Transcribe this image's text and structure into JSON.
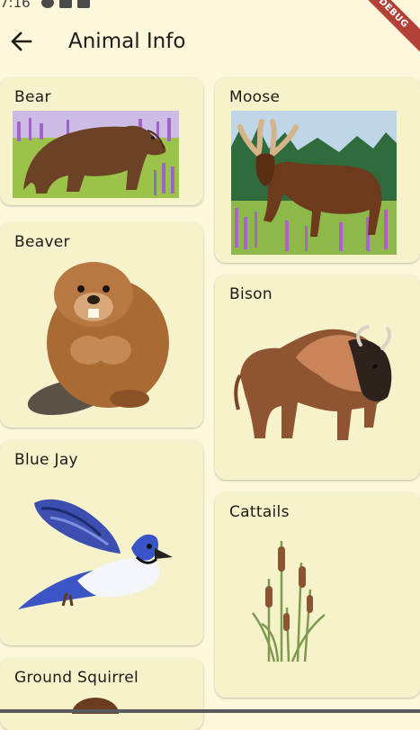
{
  "status": {
    "time": "7:16"
  },
  "debug_banner": "DEBUG",
  "appbar": {
    "title": "Animal Info",
    "back_icon": "arrow-back-icon"
  },
  "animals": [
    {
      "label": "Bear"
    },
    {
      "label": "Moose"
    },
    {
      "label": "Beaver"
    },
    {
      "label": "Bison"
    },
    {
      "label": "Blue Jay"
    },
    {
      "label": "Cattails"
    },
    {
      "label": "Ground Squirrel"
    }
  ],
  "colors": {
    "background": "#fdf8dc",
    "card": "#f6f2cc",
    "text": "#1d1b16"
  }
}
